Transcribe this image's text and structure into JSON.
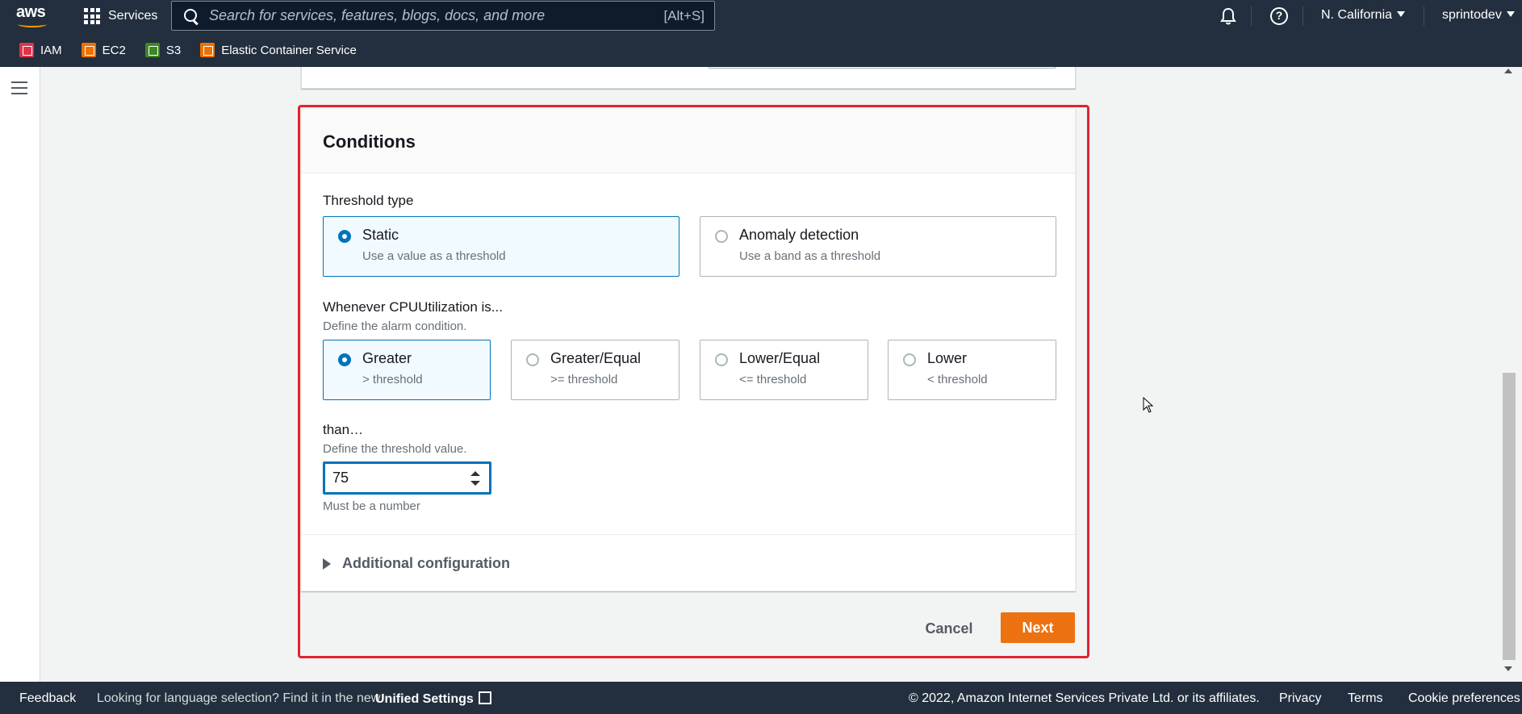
{
  "topnav": {
    "logo": "aws",
    "services_label": "Services",
    "search_placeholder": "Search for services, features, blogs, docs, and more",
    "search_shortcut": "[Alt+S]",
    "region": "N. California",
    "user": "sprintodev",
    "favorites": [
      {
        "label": "IAM",
        "color": "#dd344c",
        "icon": "iam-icon"
      },
      {
        "label": "EC2",
        "color": "#ed7100",
        "icon": "ec2-icon"
      },
      {
        "label": "S3",
        "color": "#3f8624",
        "icon": "s3-icon"
      },
      {
        "label": "Elastic Container Service",
        "color": "#ed7100",
        "icon": "ecs-icon"
      }
    ]
  },
  "conditions": {
    "title": "Conditions",
    "threshold_type": {
      "label": "Threshold type",
      "options": [
        {
          "title": "Static",
          "subtitle": "Use a value as a threshold",
          "selected": true
        },
        {
          "title": "Anomaly detection",
          "subtitle": "Use a band as a threshold",
          "selected": false
        }
      ]
    },
    "whenever": {
      "label": "Whenever CPUUtilization is...",
      "description": "Define the alarm condition.",
      "options": [
        {
          "title": "Greater",
          "subtitle": "> threshold",
          "selected": true
        },
        {
          "title": "Greater/Equal",
          "subtitle": ">= threshold",
          "selected": false
        },
        {
          "title": "Lower/Equal",
          "subtitle": "<= threshold",
          "selected": false
        },
        {
          "title": "Lower",
          "subtitle": "< threshold",
          "selected": false
        }
      ]
    },
    "than": {
      "label": "than…",
      "description": "Define the threshold value.",
      "value": "75",
      "constraint": "Must be a number"
    },
    "additional_configuration": "Additional configuration"
  },
  "actions": {
    "cancel": "Cancel",
    "next": "Next"
  },
  "colors": {
    "highlight": "#e0242e",
    "primary_button": "#ec7211",
    "selected_border": "#0073bb",
    "nav_bg": "#232f3e"
  },
  "footer": {
    "feedback": "Feedback",
    "language_prompt": "Looking for language selection? Find it in the new",
    "unified_settings": "Unified Settings",
    "copyright": "© 2022, Amazon Internet Services Private Ltd. or its affiliates.",
    "privacy": "Privacy",
    "terms": "Terms",
    "cookies": "Cookie preferences"
  }
}
